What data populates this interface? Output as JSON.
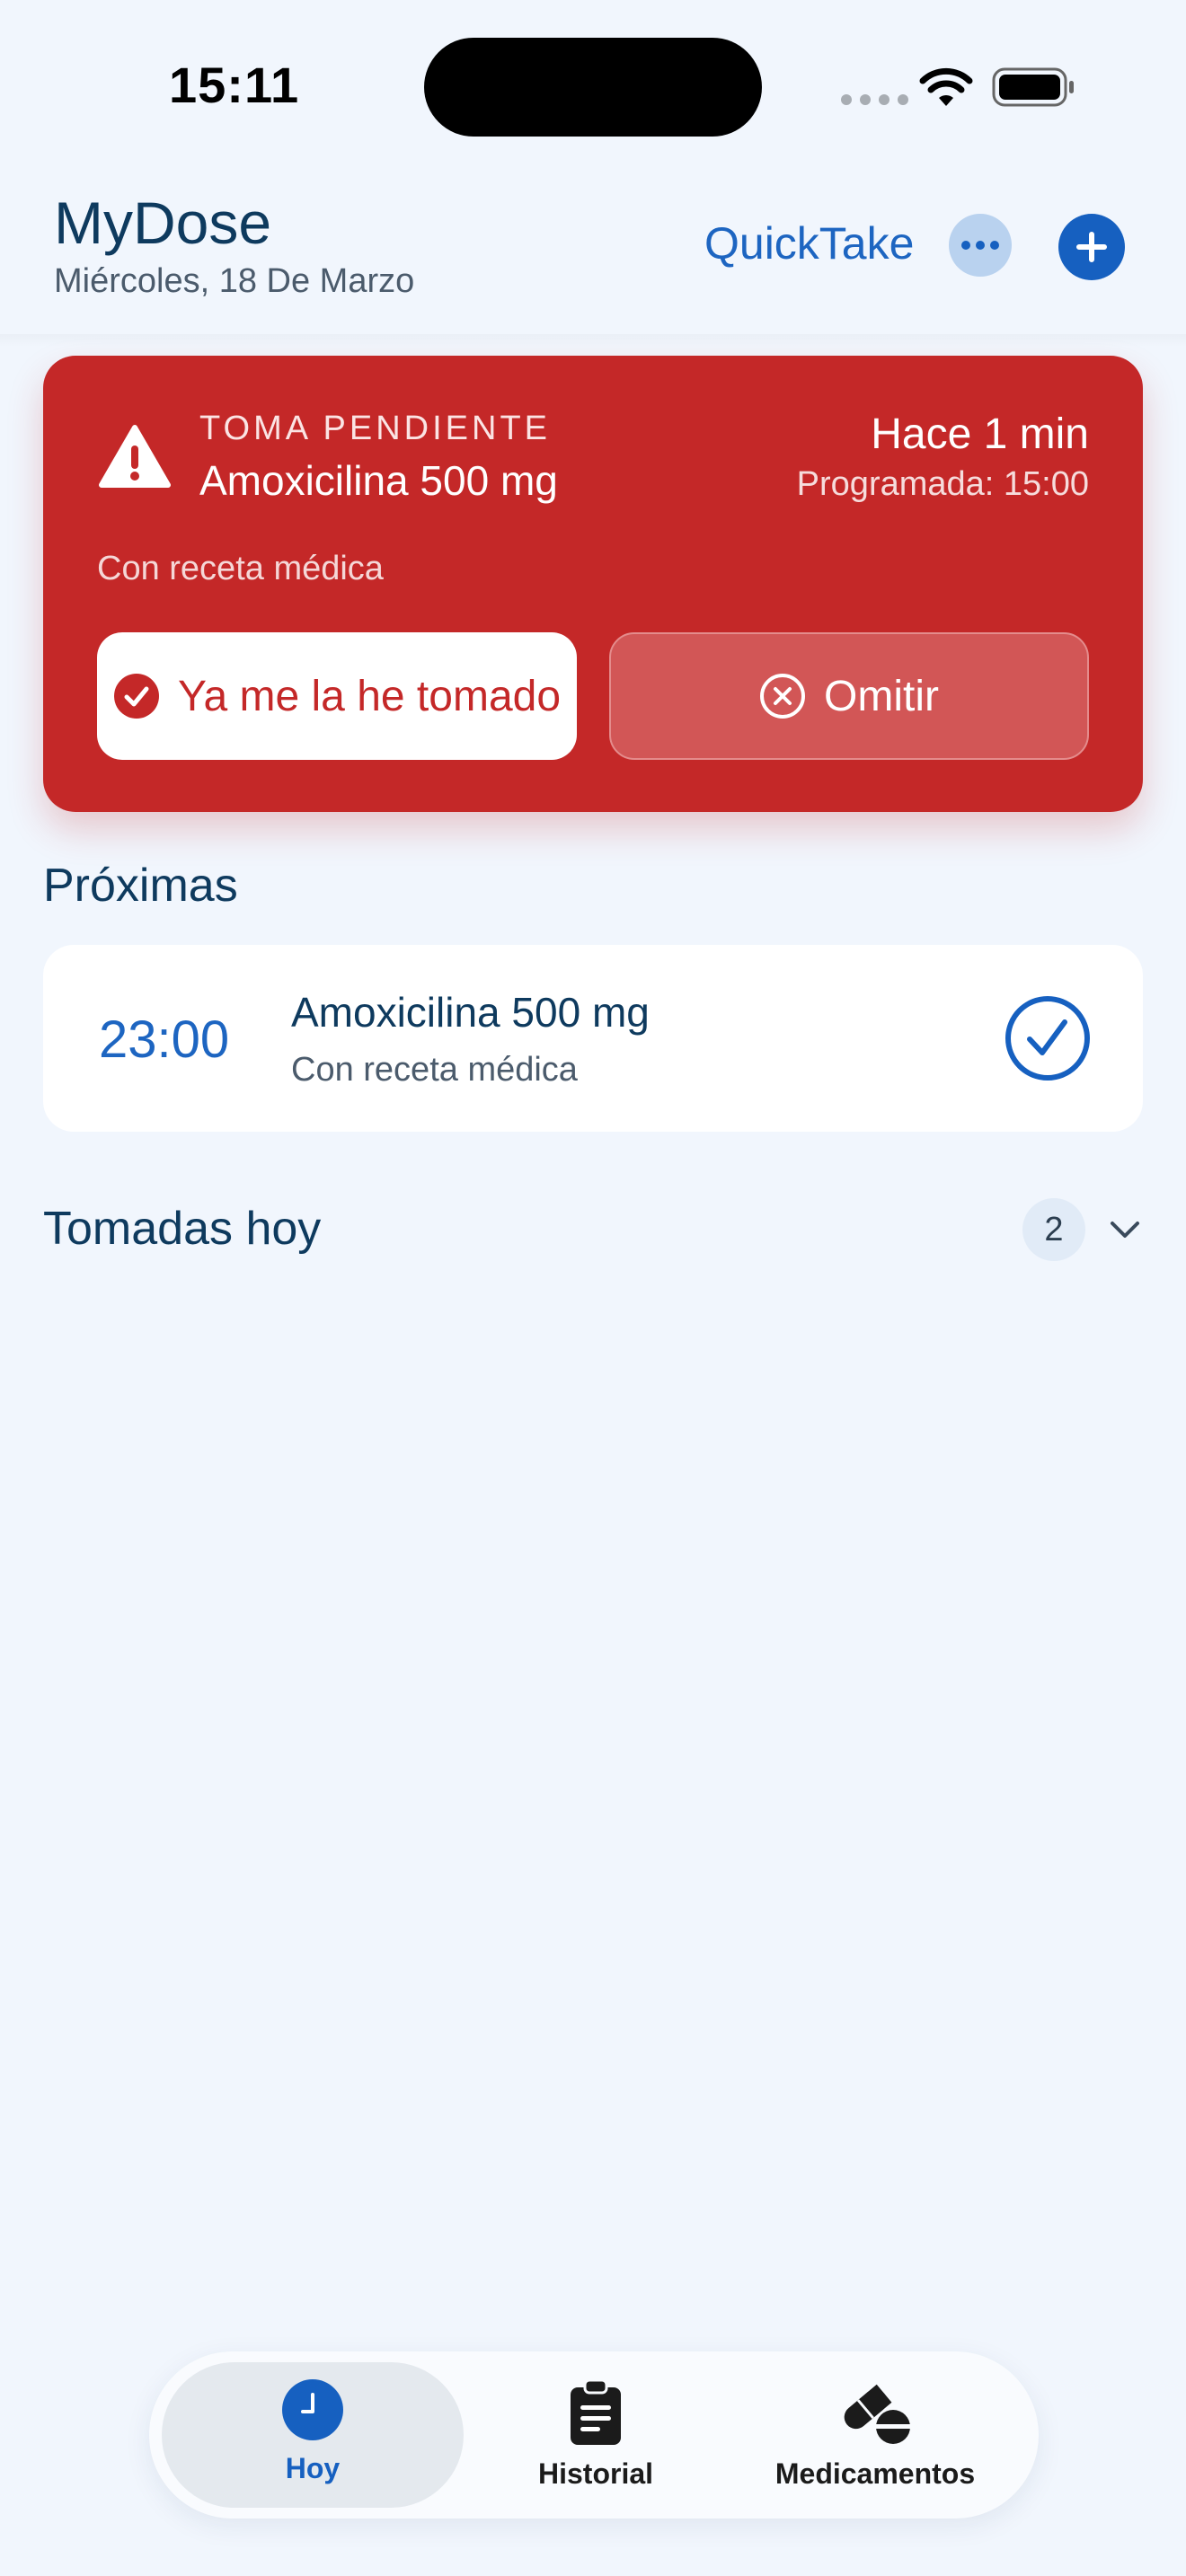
{
  "status_bar": {
    "time": "15:11"
  },
  "header": {
    "title": "MyDose",
    "date": "Miércoles, 18 De Marzo",
    "quicktake_label": "QuickTake",
    "accent_color": "#1660C0"
  },
  "pending_alert": {
    "kicker": "TOMA PENDIENTE",
    "medication": "Amoxicilina 500 mg",
    "elapsed": "Hace 1 min",
    "scheduled": "Programada: 15:00",
    "note": "Con receta médica",
    "taken_button": "Ya me la he tomado",
    "skip_button": "Omitir",
    "color": "#C42828"
  },
  "upcoming": {
    "title": "Próximas",
    "items": [
      {
        "time": "23:00",
        "medication": "Amoxicilina 500 mg",
        "note": "Con receta médica"
      }
    ]
  },
  "taken_today": {
    "title": "Tomadas hoy",
    "count": "2"
  },
  "tabbar": {
    "tabs": [
      {
        "label": "Hoy",
        "icon": "clock-icon",
        "active": true
      },
      {
        "label": "Historial",
        "icon": "clipboard-icon",
        "active": false
      },
      {
        "label": "Medicamentos",
        "icon": "pills-icon",
        "active": false
      }
    ]
  }
}
